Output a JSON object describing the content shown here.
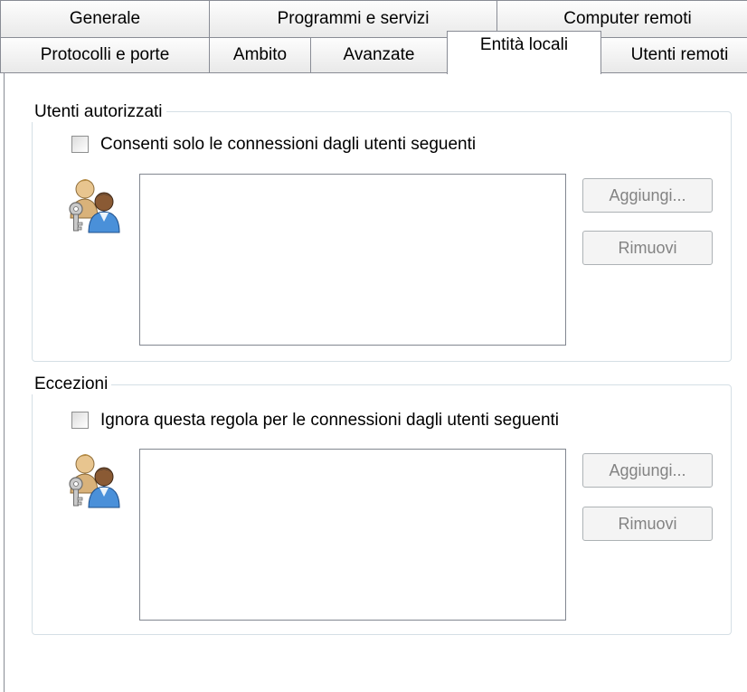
{
  "tabs": {
    "row1": [
      {
        "label": "Generale"
      },
      {
        "label": "Programmi e servizi"
      },
      {
        "label": "Computer remoti"
      }
    ],
    "row2": [
      {
        "label": "Protocolli e porte"
      },
      {
        "label": "Ambito"
      },
      {
        "label": "Avanzate"
      },
      {
        "label": "Entità locali",
        "active": true
      },
      {
        "label": "Utenti remoti"
      }
    ]
  },
  "authorized_users": {
    "title": "Utenti autorizzati",
    "checkbox_label": "Consenti solo le connessioni dagli utenti seguenti",
    "checked": false,
    "items": [],
    "add_button": "Aggiungi...",
    "remove_button": "Rimuovi",
    "icon": "users-key-icon"
  },
  "exceptions": {
    "title": "Eccezioni",
    "checkbox_label": "Ignora questa regola per le connessioni dagli utenti seguenti",
    "checked": false,
    "items": [],
    "add_button": "Aggiungi...",
    "remove_button": "Rimuovi",
    "icon": "users-key-icon"
  },
  "colors": {
    "tab_border": "#898c95",
    "groupbox_border": "#d5dfe5",
    "disabled_text": "#838383"
  }
}
